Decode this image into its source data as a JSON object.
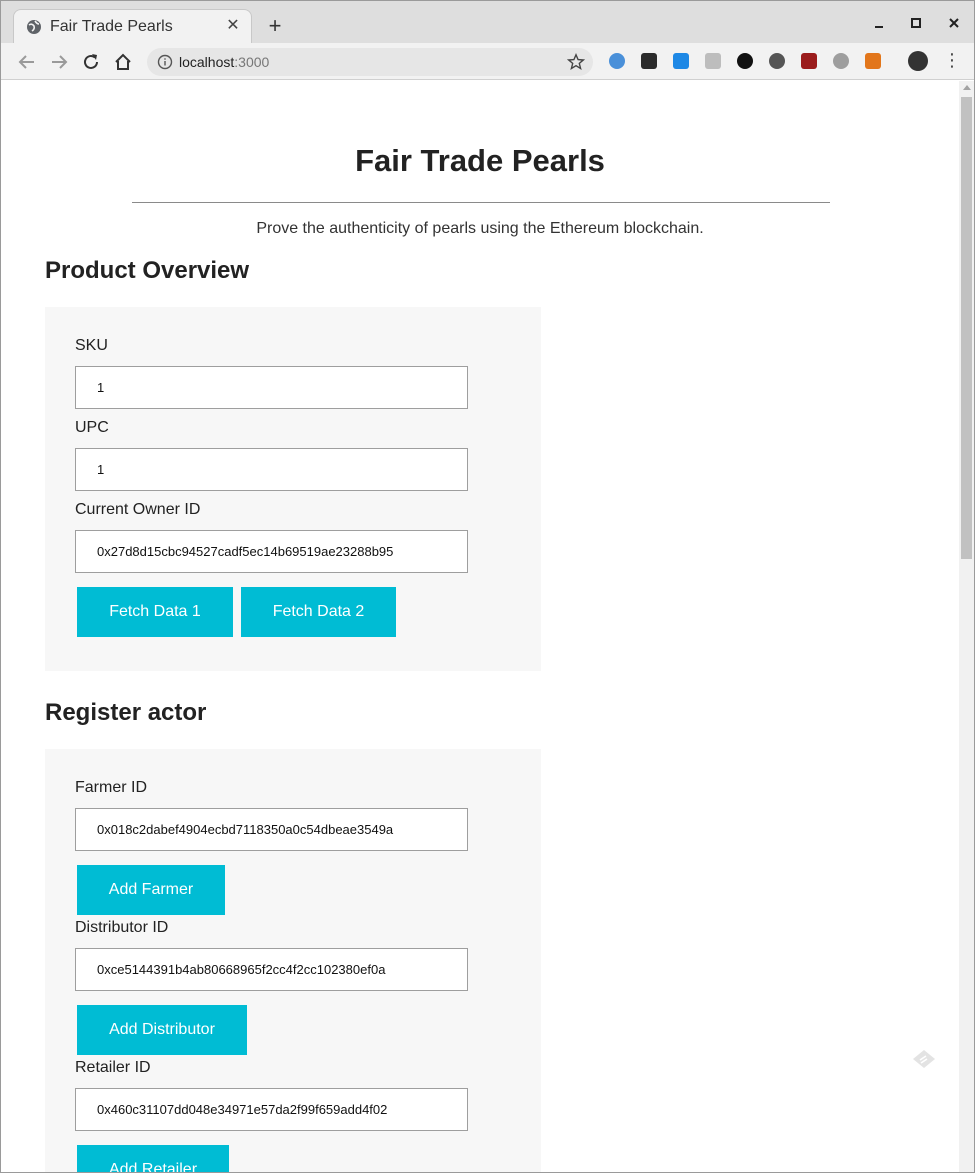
{
  "browser": {
    "tab_title": "Fair Trade Pearls",
    "tab_close": "✕",
    "new_tab": "+",
    "url_host": "localhost",
    "url_port": ":3000",
    "menu": "⋮",
    "extensions": [
      {
        "name": "extension-blue",
        "color": "#4a90d9"
      },
      {
        "name": "extension-k",
        "color": "#2b2b2b"
      },
      {
        "name": "extension-s",
        "color": "#1e88e5"
      },
      {
        "name": "extension-grey",
        "color": "#bdbdbd"
      },
      {
        "name": "extension-gnome",
        "color": "#111111"
      },
      {
        "name": "extension-circle",
        "color": "#555555"
      },
      {
        "name": "extension-ublock",
        "color": "#9b1c1c"
      },
      {
        "name": "extension-hex",
        "color": "#9e9e9e"
      },
      {
        "name": "extension-fox",
        "color": "#e2761b"
      }
    ]
  },
  "page": {
    "title": "Fair Trade Pearls",
    "tagline": "Prove the authenticity of pearls using the Ethereum blockchain."
  },
  "product_overview": {
    "heading": "Product Overview",
    "sku_label": "SKU",
    "sku_value": "1",
    "upc_label": "UPC",
    "upc_value": "1",
    "owner_label": "Current Owner ID",
    "owner_value": "0x27d8d15cbc94527cadf5ec14b69519ae23288b95",
    "fetch1_label": "Fetch Data 1",
    "fetch2_label": "Fetch Data 2"
  },
  "register_actor": {
    "heading": "Register actor",
    "farmer_label": "Farmer ID",
    "farmer_value": "0x018c2dabef4904ecbd7118350a0c54dbeae3549a",
    "add_farmer_label": "Add Farmer",
    "distributor_label": "Distributor ID",
    "distributor_value": "0xce5144391b4ab80668965f2cc4f2cc102380ef0a",
    "add_distributor_label": "Add Distributor",
    "retailer_label": "Retailer ID",
    "retailer_value": "0x460c31107dd048e34971e57da2f99f659add4f02",
    "add_retailer_label": "Add Retailer"
  },
  "colors": {
    "accent": "#00bcd4",
    "panel_bg": "#f7f7f7"
  }
}
